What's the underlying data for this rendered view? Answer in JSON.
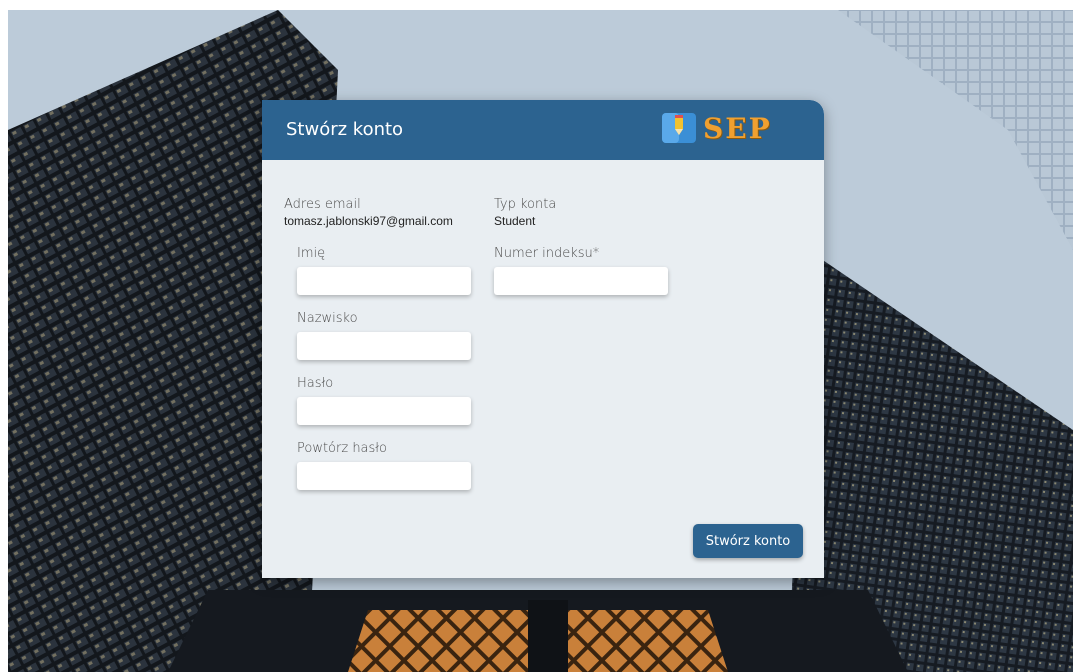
{
  "colors": {
    "header": "#2c6390",
    "card": "#e9eef2",
    "button": "#2c6390",
    "logo_text": "#f0a030"
  },
  "header": {
    "title": "Stwórz konto",
    "logo_text": "SEP",
    "logo_icon": "pencil-book-icon"
  },
  "form": {
    "email": {
      "label": "Adres email",
      "value": "tomasz.jablonski97@gmail.com"
    },
    "account_type": {
      "label": "Typ konta",
      "value": "Student"
    },
    "first_name": {
      "label": "Imię",
      "value": "",
      "placeholder": ""
    },
    "index_number": {
      "label": "Numer indeksu*",
      "value": "",
      "placeholder": ""
    },
    "last_name": {
      "label": "Nazwisko",
      "value": "",
      "placeholder": ""
    },
    "password": {
      "label": "Hasło",
      "value": "",
      "placeholder": ""
    },
    "repeat_password": {
      "label": "Powtórz hasło",
      "value": "",
      "placeholder": ""
    },
    "submit_label": "Stwórz konto"
  }
}
